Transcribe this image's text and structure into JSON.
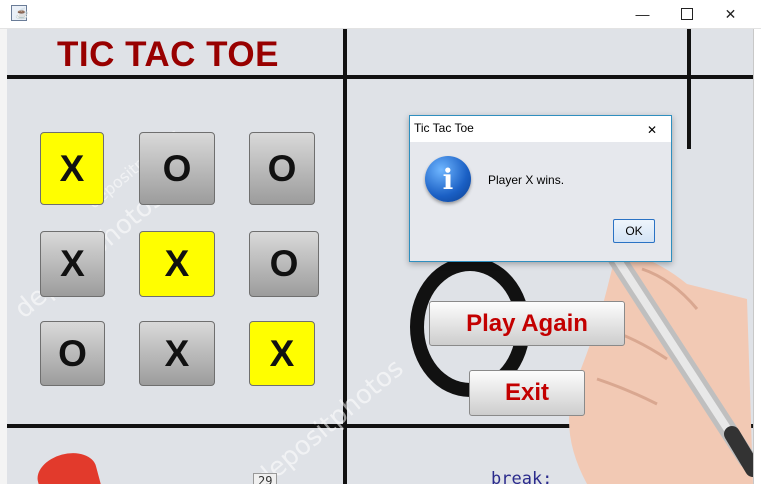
{
  "window": {
    "title": "",
    "icon": "java-icon",
    "controls": [
      "minimize-icon",
      "maximize-icon",
      "close-icon"
    ]
  },
  "game": {
    "title": "TIC TAC TOE",
    "board": [
      {
        "mark": "X",
        "winning": true
      },
      {
        "mark": "O",
        "winning": false
      },
      {
        "mark": "O",
        "winning": false
      },
      {
        "mark": "X",
        "winning": false
      },
      {
        "mark": "X",
        "winning": true
      },
      {
        "mark": "O",
        "winning": false
      },
      {
        "mark": "O",
        "winning": false
      },
      {
        "mark": "X",
        "winning": false
      },
      {
        "mark": "X",
        "winning": true
      }
    ],
    "play_again_label": "Play Again",
    "exit_label": "Exit",
    "watermark": "depositphotos"
  },
  "dialog": {
    "title": "Tic Tac Toe",
    "message": "Player X wins.",
    "ok_label": "OK",
    "icon": "info-icon"
  },
  "background_code": {
    "text": "break;",
    "number": "29"
  },
  "colors": {
    "title_red": "#980000",
    "button_red": "#c30000",
    "winning_cell": "#fffe00"
  }
}
